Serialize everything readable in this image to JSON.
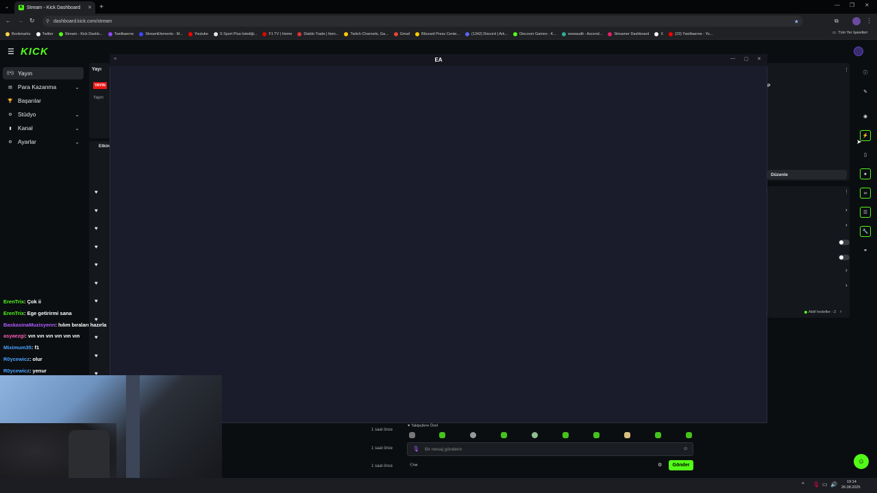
{
  "browser": {
    "tab_title": "Stream - Kick Dashboard",
    "url": "dashboard.kick.com/stream",
    "new_tab_symbol": "+",
    "bookmarks": [
      {
        "label": "Bookmarks",
        "color": "#ffd24a"
      },
      {
        "label": "Twitter",
        "color": "#ffffff"
      },
      {
        "label": "Stream - Kick Dashb...",
        "color": "#53fc18"
      },
      {
        "label": "Twelbaerne",
        "color": "#9146ff"
      },
      {
        "label": "StreamElements - M...",
        "color": "#3b46ff"
      },
      {
        "label": "Youtube",
        "color": "#ff0000"
      },
      {
        "label": "S Sport Plus-İstediği...",
        "color": "#e6e6e6"
      },
      {
        "label": "F1 TV | Home",
        "color": "#e10600"
      },
      {
        "label": "Diablo Trade | Item...",
        "color": "#d33"
      },
      {
        "label": "Twitch Channels, Ga...",
        "color": "#ffcc00"
      },
      {
        "label": "Gmail",
        "color": "#ea4335"
      },
      {
        "label": "Blizzard Press Cente...",
        "color": "#ffcc00"
      },
      {
        "label": "(1342) Discord | Ark...",
        "color": "#5865f2"
      },
      {
        "label": "Discover Games - K...",
        "color": "#53fc18"
      },
      {
        "label": "wowaudit - Ascend...",
        "color": "#3a9"
      },
      {
        "label": "Streamer Dashboard",
        "color": "#e91e63"
      },
      {
        "label": "X",
        "color": "#ffffff"
      },
      {
        "label": "(23) Twelbaerne - Yo...",
        "color": "#ff0000"
      }
    ],
    "all_bookmarks_label": "Tüm Yer İşaretleri"
  },
  "kick": {
    "logo": "KICK",
    "nav": [
      {
        "label": "Yayın",
        "icon": "broadcast-icon",
        "glyph": "((•))",
        "active": true,
        "expandable": false
      },
      {
        "label": "Para Kazanma",
        "icon": "money-icon",
        "glyph": "▤",
        "active": false,
        "expandable": true
      },
      {
        "label": "Başarılar",
        "icon": "trophy-icon",
        "glyph": "🏆",
        "active": false,
        "expandable": false
      },
      {
        "label": "Stüdyo",
        "icon": "studio-icon",
        "glyph": "⚙",
        "active": false,
        "expandable": true
      },
      {
        "label": "Kanal",
        "icon": "channel-icon",
        "glyph": "▮",
        "active": false,
        "expandable": true
      },
      {
        "label": "Ayarlar",
        "icon": "settings-icon",
        "glyph": "⚙",
        "active": false,
        "expandable": true
      }
    ],
    "panel_stream_title": "Yayı",
    "live_badge": "YAYIN",
    "panel_stream_sub": "Yayın",
    "activity_title": "Etkin",
    "duzenle": "Düzenle",
    "right_p": "P",
    "active_goals": "Aktif hedefler - 2",
    "ago_label": "1 saat önce",
    "followers_only": "Takipçilere Özel",
    "chat_placeholder": "Bir mesaj gönderin",
    "send_label": "Gönder"
  },
  "ea_window": {
    "title": "EA"
  },
  "chat_overlay": [
    {
      "user": "ErenTrix",
      "color": "#53fc18",
      "message": ": Çok ii"
    },
    {
      "user": "ErenTrix",
      "color": "#53fc18",
      "message": ": Ege getirirmi sana"
    },
    {
      "user": "BaskasinaMuzisyenn",
      "color": "#b05cff",
      "message": ": hılım bıraları hazırla"
    },
    {
      "user": "asyaezgi",
      "color": "#ff5cb8",
      "message": ":  vın vın vın vın vın vın"
    },
    {
      "user": "Miximum35",
      "color": "#4aa3ff",
      "message": ": f1"
    },
    {
      "user": "R0ycewicz",
      "color": "#4aa3ff",
      "message": ": olur"
    },
    {
      "user": "R0ycewicz",
      "color": "#4aa3ff",
      "message": ": yenur"
    }
  ],
  "taskbar": {
    "time": "19:14",
    "date": "26.08.2025"
  }
}
